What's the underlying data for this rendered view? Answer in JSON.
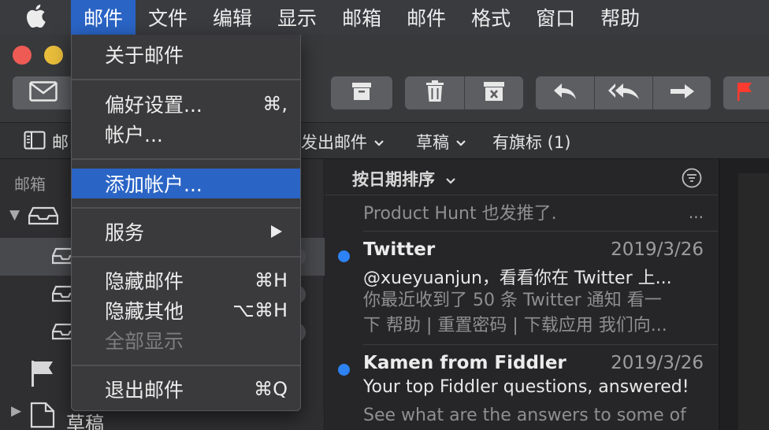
{
  "menubar": {
    "apple_icon": "apple-logo-icon",
    "items": [
      "邮件",
      "文件",
      "编辑",
      "显示",
      "邮箱",
      "邮件",
      "格式",
      "窗口",
      "帮助"
    ],
    "active_index": 0
  },
  "dropdown": {
    "about": "关于邮件",
    "preferences": "偏好设置...",
    "preferences_shortcut": "⌘,",
    "accounts": "帐户...",
    "add_account": "添加帐户...",
    "services": "服务",
    "hide_mail": "隐藏邮件",
    "hide_mail_shortcut": "⌘H",
    "hide_others": "隐藏其他",
    "hide_others_shortcut": "⌥⌘H",
    "show_all": "全部显示",
    "quit": "退出邮件",
    "quit_shortcut": "⌘Q"
  },
  "favorites": {
    "mailboxes_partial": "邮",
    "sent": "发出邮件",
    "drafts": "草稿",
    "flagged": "有旗标 (1)"
  },
  "sidebar": {
    "heading": "邮箱",
    "drafts_label": "草稿"
  },
  "message_list": {
    "sort_label": "按日期排序",
    "partial_preview": "Product Hunt 也发推了.",
    "partial_more": "...",
    "messages": [
      {
        "sender": "Twitter",
        "date": "2019/3/26",
        "subject": "@xueyuanjun，看看你在 Twitter 上...",
        "preview_line1": "你最近收到了 50 条 Twitter 通知 看一",
        "preview_line2": "下 帮助 | 重置密码 | 下载应用 我们向..."
      },
      {
        "sender": "Kamen from Fiddler",
        "date": "2019/3/26",
        "subject": "Your top Fiddler questions, answered!",
        "preview_line1": "See what are the answers to some of"
      }
    ]
  },
  "colors": {
    "accent": "#2a64c5",
    "unread_dot": "#2d82f5",
    "flag_red": "#ff3b30"
  }
}
